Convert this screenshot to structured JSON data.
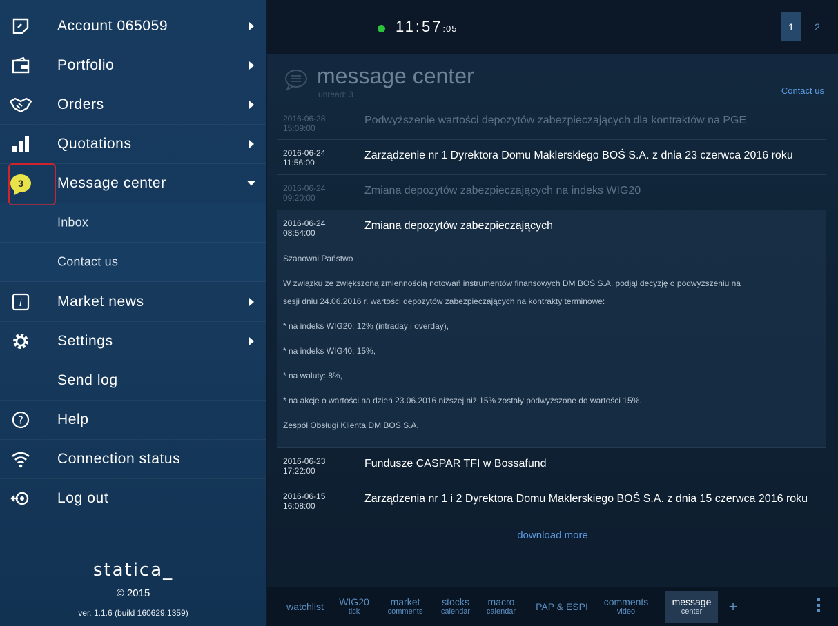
{
  "sidebar": {
    "items": [
      {
        "label": "Account 065059",
        "icon": "account-icon"
      },
      {
        "label": "Portfolio",
        "icon": "wallet-icon"
      },
      {
        "label": "Orders",
        "icon": "handshake-icon"
      },
      {
        "label": "Quotations",
        "icon": "bar-chart-icon"
      },
      {
        "label": "Message center",
        "icon": "message-badge-icon",
        "badge": "3"
      },
      {
        "label": "Inbox"
      },
      {
        "label": "Contact us"
      },
      {
        "label": "Market news",
        "icon": "info-icon"
      },
      {
        "label": "Settings",
        "icon": "gear-icon"
      },
      {
        "label": "Send log"
      },
      {
        "label": "Help",
        "icon": "help-icon"
      },
      {
        "label": "Connection status",
        "icon": "wifi-icon"
      },
      {
        "label": "Log out",
        "icon": "logout-icon"
      }
    ],
    "brand": "statica_",
    "copyright": "2015",
    "version": "ver. 1.1.6 (build 160629.1359)"
  },
  "topbar": {
    "clock_hm": "11:57",
    "clock_sec": ":05",
    "pages": [
      "1",
      "2"
    ],
    "active_page": "1",
    "status_color": "#2bc23e"
  },
  "message_center": {
    "title": "message center",
    "unread": "unread: 3",
    "contact": "Contact us",
    "messages": [
      {
        "date": "2016-06-28",
        "time": "15:09:00",
        "title": "Podwyższenie wartości depozytów zabezpieczających dla kontraktów na PGE",
        "read": true
      },
      {
        "date": "2016-06-24",
        "time": "11:56:00",
        "title": "Zarządzenie nr 1 Dyrektora Domu Maklerskiego BOŚ S.A. z dnia 23 czerwca 2016 roku",
        "read": false
      },
      {
        "date": "2016-06-24",
        "time": "09:20:00",
        "title": "Zmiana depozytów zabezpieczających na indeks WIG20",
        "read": true
      },
      {
        "date": "2016-06-24",
        "time": "08:54:00",
        "title": "Zmiana depozytów zabezpieczających",
        "read": false,
        "body": [
          "Szanowni Państwo",
          "W związku ze zwiększoną zmiennością notowań instrumentów finansowych DM BOŚ S.A. podjął decyzję o podwyższeniu na",
          "sesji dniu 24.06.2016 r. wartości depozytów zabezpieczających na kontrakty terminowe:",
          "* na indeks WIG20: 12% (intraday i overday),",
          "* na indeks WIG40: 15%,",
          "* na waluty: 8%,",
          "* na akcje o wartości na dzień 23.06.2016 niższej niż 15% zostały podwyższone do wartości 15%.",
          "Zespół Obsługi Klienta DM BOŚ S.A."
        ]
      },
      {
        "date": "2016-06-23",
        "time": "17:22:00",
        "title": "Fundusze CASPAR TFI w Bossafund",
        "read": false
      },
      {
        "date": "2016-06-15",
        "time": "16:08:00",
        "title": "Zarządzenia nr 1 i 2 Dyrektora Domu Maklerskiego BOŚ S.A. z dnia 15 czerwca 2016 roku",
        "read": false
      }
    ],
    "download_more": "download more"
  },
  "bottom_tabs": [
    {
      "label": "watchlist",
      "sub": ""
    },
    {
      "label": "WIG20",
      "sub": "tick"
    },
    {
      "label": "market",
      "sub": "comments"
    },
    {
      "label": "stocks",
      "sub": "calendar"
    },
    {
      "label": "macro",
      "sub": "calendar"
    },
    {
      "label": "PAP & ESPI",
      "sub": ""
    },
    {
      "label": "comments",
      "sub": "video"
    },
    {
      "label": "message",
      "sub": "center"
    },
    {
      "label": "+",
      "sub": ""
    }
  ]
}
